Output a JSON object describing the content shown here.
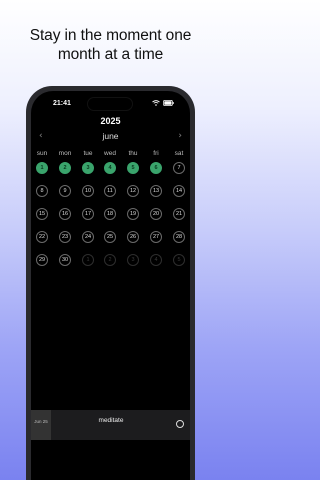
{
  "headline": {
    "line1": "Stay in the moment one",
    "line2": "month at a time"
  },
  "status_bar": {
    "time": "21:41"
  },
  "calendar": {
    "year": "2025",
    "month": "june",
    "prev_icon": "‹",
    "next_icon": "›",
    "weekdays": [
      "sun",
      "mon",
      "tue",
      "wed",
      "thu",
      "fri",
      "sat"
    ],
    "weeks": [
      [
        {
          "d": "1",
          "s": "done"
        },
        {
          "d": "2",
          "s": "done"
        },
        {
          "d": "3",
          "s": "done"
        },
        {
          "d": "4",
          "s": "done"
        },
        {
          "d": "5",
          "s": "done"
        },
        {
          "d": "6",
          "s": "done"
        },
        {
          "d": "7",
          "s": "normal"
        }
      ],
      [
        {
          "d": "8",
          "s": "normal"
        },
        {
          "d": "9",
          "s": "normal"
        },
        {
          "d": "10",
          "s": "normal"
        },
        {
          "d": "11",
          "s": "normal"
        },
        {
          "d": "12",
          "s": "normal"
        },
        {
          "d": "13",
          "s": "normal"
        },
        {
          "d": "14",
          "s": "normal"
        }
      ],
      [
        {
          "d": "15",
          "s": "normal"
        },
        {
          "d": "16",
          "s": "normal"
        },
        {
          "d": "17",
          "s": "normal"
        },
        {
          "d": "18",
          "s": "normal"
        },
        {
          "d": "19",
          "s": "normal"
        },
        {
          "d": "20",
          "s": "normal"
        },
        {
          "d": "21",
          "s": "normal"
        }
      ],
      [
        {
          "d": "22",
          "s": "normal"
        },
        {
          "d": "23",
          "s": "normal"
        },
        {
          "d": "24",
          "s": "normal"
        },
        {
          "d": "25",
          "s": "normal"
        },
        {
          "d": "26",
          "s": "normal"
        },
        {
          "d": "27",
          "s": "normal"
        },
        {
          "d": "28",
          "s": "normal"
        }
      ],
      [
        {
          "d": "29",
          "s": "normal"
        },
        {
          "d": "30",
          "s": "normal"
        },
        {
          "d": "1",
          "s": "dim"
        },
        {
          "d": "2",
          "s": "dim"
        },
        {
          "d": "3",
          "s": "dim"
        },
        {
          "d": "4",
          "s": "dim"
        },
        {
          "d": "5",
          "s": "dim"
        }
      ]
    ]
  },
  "player": {
    "thumb_label": "Jun 25",
    "title": "meditate"
  },
  "colors": {
    "done": "#3aa46c",
    "background_bottom": "#7a82f0"
  }
}
